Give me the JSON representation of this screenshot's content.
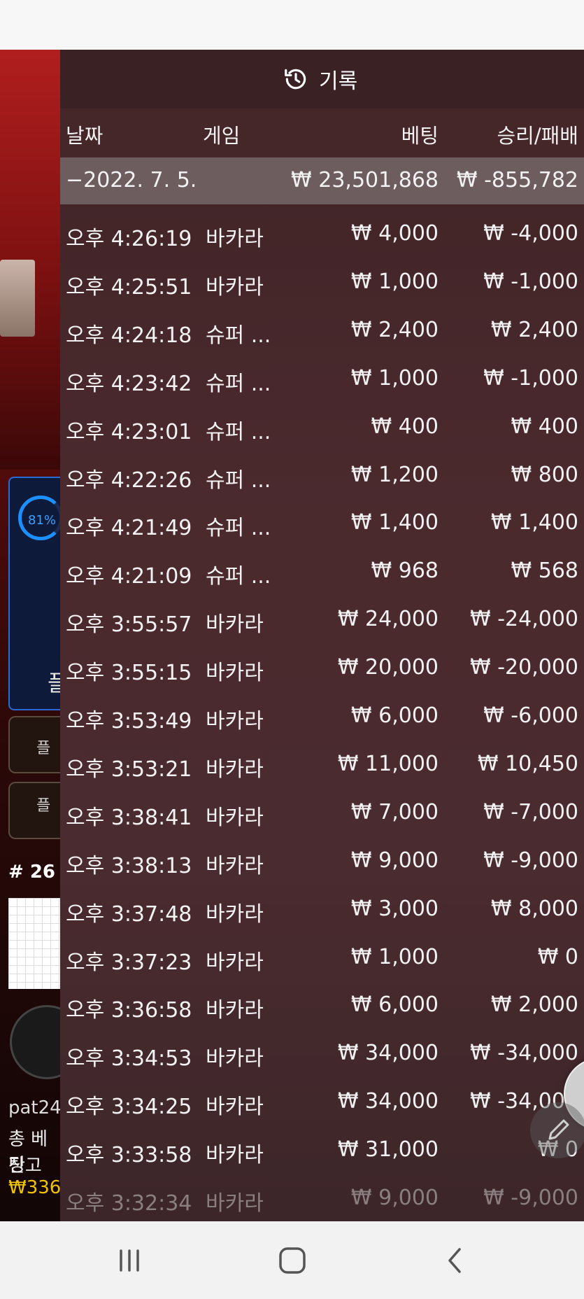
{
  "history": {
    "title": "기록",
    "columns": {
      "date": "날짜",
      "game": "게임",
      "bet": "베팅",
      "winloss": "승리/패배"
    },
    "summary": {
      "date": "−2022. 7. 5.",
      "bet": "₩ 23,501,868",
      "winloss": "₩ -855,782"
    },
    "rows": [
      {
        "time": "오후 4:26:19",
        "game": "바카라",
        "bet": "₩ 4,000",
        "winloss": "₩ -4,000"
      },
      {
        "time": "오후 4:25:51",
        "game": "바카라",
        "bet": "₩ 1,000",
        "winloss": "₩ -1,000"
      },
      {
        "time": "오후 4:24:18",
        "game": "슈퍼 ...",
        "bet": "₩ 2,400",
        "winloss": "₩ 2,400"
      },
      {
        "time": "오후 4:23:42",
        "game": "슈퍼 ...",
        "bet": "₩ 1,000",
        "winloss": "₩ -1,000"
      },
      {
        "time": "오후 4:23:01",
        "game": "슈퍼 ...",
        "bet": "₩ 400",
        "winloss": "₩ 400"
      },
      {
        "time": "오후 4:22:26",
        "game": "슈퍼 ...",
        "bet": "₩ 1,200",
        "winloss": "₩ 800"
      },
      {
        "time": "오후 4:21:49",
        "game": "슈퍼 ...",
        "bet": "₩ 1,400",
        "winloss": "₩ 1,400"
      },
      {
        "time": "오후 4:21:09",
        "game": "슈퍼 ...",
        "bet": "₩ 968",
        "winloss": "₩ 568"
      },
      {
        "time": "오후 3:55:57",
        "game": "바카라",
        "bet": "₩ 24,000",
        "winloss": "₩ -24,000"
      },
      {
        "time": "오후 3:55:15",
        "game": "바카라",
        "bet": "₩ 20,000",
        "winloss": "₩ -20,000"
      },
      {
        "time": "오후 3:53:49",
        "game": "바카라",
        "bet": "₩ 6,000",
        "winloss": "₩ -6,000"
      },
      {
        "time": "오후 3:53:21",
        "game": "바카라",
        "bet": "₩ 11,000",
        "winloss": "₩ 10,450"
      },
      {
        "time": "오후 3:38:41",
        "game": "바카라",
        "bet": "₩ 7,000",
        "winloss": "₩ -7,000"
      },
      {
        "time": "오후 3:38:13",
        "game": "바카라",
        "bet": "₩ 9,000",
        "winloss": "₩ -9,000"
      },
      {
        "time": "오후 3:37:48",
        "game": "바카라",
        "bet": "₩ 3,000",
        "winloss": "₩ 8,000"
      },
      {
        "time": "오후 3:37:23",
        "game": "바카라",
        "bet": "₩ 1,000",
        "winloss": "₩ 0"
      },
      {
        "time": "오후 3:36:58",
        "game": "바카라",
        "bet": "₩ 6,000",
        "winloss": "₩ 2,000"
      },
      {
        "time": "오후 3:34:53",
        "game": "바카라",
        "bet": "₩ 34,000",
        "winloss": "₩ -34,000"
      },
      {
        "time": "오후 3:34:25",
        "game": "바카라",
        "bet": "₩ 34,000",
        "winloss": "₩ -34,000"
      },
      {
        "time": "오후 3:33:58",
        "game": "바카라",
        "bet": "₩ 31,000",
        "winloss": "₩ 0"
      },
      {
        "time": "오후 3:32:34",
        "game": "바카라",
        "bet": "₩ 9,000",
        "winloss": "₩ -9,000"
      }
    ]
  },
  "game_bg": {
    "progress_percent": "81%",
    "player_label": "플",
    "button1_label": "플",
    "button2_label": "플",
    "round": "# 26",
    "username": "pat24",
    "total_bet_label": "총 베팅",
    "balance_label": "잔고",
    "balance_value": "₩336"
  },
  "buttons": {
    "close_icon": "close-icon",
    "edit_icon": "pencil-icon"
  },
  "navbar": {
    "recents_icon": "recents-icon",
    "home_icon": "home-icon",
    "back_icon": "back-icon"
  }
}
